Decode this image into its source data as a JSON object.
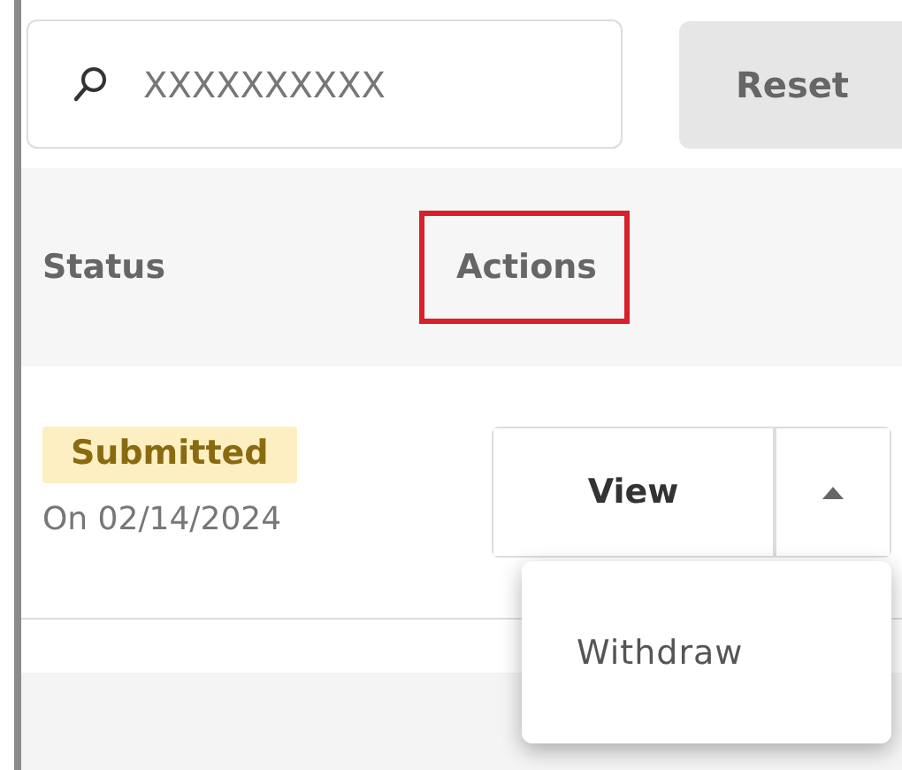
{
  "search": {
    "value": "XXXXXXXXXX"
  },
  "reset_button": {
    "label": "Reset"
  },
  "table": {
    "columns": [
      {
        "label": "Status",
        "highlighted": false
      },
      {
        "label": "Actions",
        "highlighted": true
      }
    ],
    "rows": [
      {
        "status": "Submitted",
        "date": "On 02/14/2024",
        "action": "View",
        "menu_open": true,
        "menu": [
          "Withdraw"
        ]
      }
    ]
  }
}
